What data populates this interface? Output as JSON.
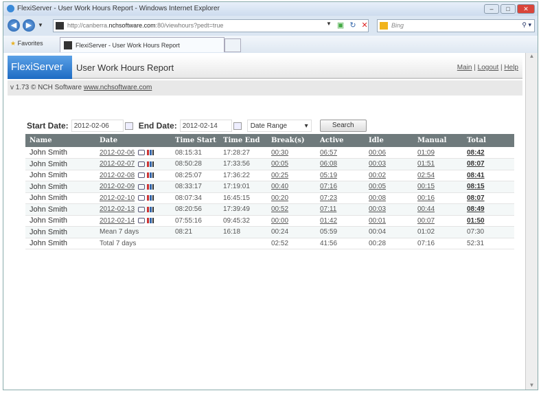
{
  "browser": {
    "title": "FlexiServer - User Work Hours Report - Windows Internet Explorer",
    "url_prefix": "http://canberra.",
    "url_domain": "nchsoftware.com",
    "url_suffix": ":80/viewhours?pedt=true",
    "search_placeholder": "Bing",
    "favorites": "Favorites",
    "tab_label": "FlexiServer - User Work Hours Report"
  },
  "header": {
    "logo": "FlexiServer",
    "title": "User Work Hours Report",
    "links": [
      "Main",
      "Logout",
      "Help"
    ],
    "sep": "|",
    "version": "v 1.73 © NCH Software",
    "website": "www.nchsoftware.com"
  },
  "form": {
    "start_label": "Start Date:",
    "start_value": "2012-02-06",
    "end_label": "End Date:",
    "end_value": "2012-02-14",
    "range": "Date Range",
    "search": "Search"
  },
  "table": {
    "headers": [
      "Name",
      "Date",
      "Time Start",
      "Time End",
      "Break(s)",
      "Active",
      "Idle",
      "Manual",
      "Total"
    ],
    "rows": [
      [
        "John Smith",
        "2012-02-06",
        "08:15:31",
        "17:28:27",
        "00:30",
        "06:57",
        "00:06",
        "01:09",
        "08:42"
      ],
      [
        "John Smith",
        "2012-02-07",
        "08:50:28",
        "17:33:56",
        "00:05",
        "06:08",
        "00:03",
        "01:51",
        "08:07"
      ],
      [
        "John Smith",
        "2012-02-08",
        "08:25:07",
        "17:36:22",
        "00:25",
        "05:19",
        "00:02",
        "02:54",
        "08:41"
      ],
      [
        "John Smith",
        "2012-02-09",
        "08:33:17",
        "17:19:01",
        "00:40",
        "07:16",
        "00:05",
        "00:15",
        "08:15"
      ],
      [
        "John Smith",
        "2012-02-10",
        "08:07:34",
        "16:45:15",
        "00:20",
        "07:23",
        "00:08",
        "00:16",
        "08:07"
      ],
      [
        "John Smith",
        "2012-02-13",
        "08:20:56",
        "17:39:49",
        "00:52",
        "07:11",
        "00:03",
        "00:44",
        "08:49"
      ],
      [
        "John Smith",
        "2012-02-14",
        "07:55:16",
        "09:45:32",
        "00:00",
        "01:42",
        "00:01",
        "00:07",
        "01:50"
      ]
    ],
    "summary": [
      [
        "John Smith",
        "Mean 7 days",
        "08:21",
        "16:18",
        "00:24",
        "05:59",
        "00:04",
        "01:02",
        "07:30"
      ],
      [
        "John Smith",
        "Total 7 days",
        "",
        "",
        "02:52",
        "41:56",
        "00:28",
        "07:16",
        "52:31"
      ]
    ]
  }
}
